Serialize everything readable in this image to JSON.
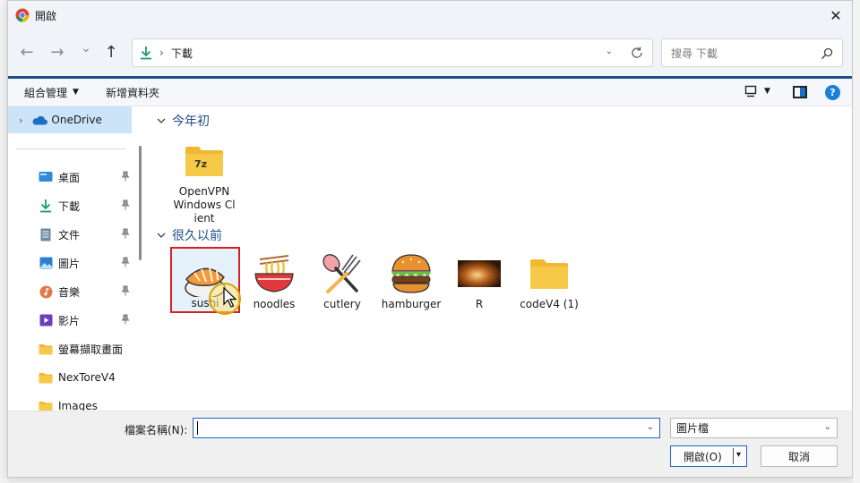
{
  "window": {
    "title": "開啟",
    "close_glyph": "✕"
  },
  "nav": {
    "back_glyph": "←",
    "forward_glyph": "→",
    "recent_glyph": "⌄",
    "up_glyph": "↑"
  },
  "address": {
    "separator": "›",
    "current": "下載",
    "dropdown_glyph": "⌄"
  },
  "search": {
    "placeholder": "搜尋 下載"
  },
  "toolbar": {
    "organize_label": "組合管理",
    "organize_caret": "▼",
    "new_folder_label": "新增資料夾",
    "view_caret": "▼",
    "help_glyph": "?"
  },
  "sidebar": {
    "onedrive": {
      "label": "OneDrive",
      "chevron": "›"
    },
    "items": [
      {
        "label": "桌面",
        "icon": "desktop-icon",
        "pinned": true
      },
      {
        "label": "下載",
        "icon": "download-icon",
        "pinned": true
      },
      {
        "label": "文件",
        "icon": "document-icon",
        "pinned": true
      },
      {
        "label": "圖片",
        "icon": "pictures-icon",
        "pinned": true
      },
      {
        "label": "音樂",
        "icon": "music-icon",
        "pinned": true
      },
      {
        "label": "影片",
        "icon": "videos-icon",
        "pinned": true
      },
      {
        "label": "螢幕擷取畫面",
        "icon": "folder-icon",
        "pinned": false
      },
      {
        "label": "NexToreV4",
        "icon": "folder-icon",
        "pinned": false
      },
      {
        "label": "Images",
        "icon": "folder-icon",
        "pinned": false
      }
    ]
  },
  "groups": [
    {
      "label": "今年初",
      "files": [
        {
          "name": "OpenVPN Windows Client",
          "icon": "zip-folder-icon"
        }
      ]
    },
    {
      "label": "很久以前",
      "files": [
        {
          "name": "sushi",
          "icon": "sushi-icon",
          "selected": true
        },
        {
          "name": "noodles",
          "icon": "noodles-icon"
        },
        {
          "name": "cutlery",
          "icon": "cutlery-icon"
        },
        {
          "name": "hamburger",
          "icon": "hamburger-icon"
        },
        {
          "name": "R",
          "icon": "image-thumbnail-icon"
        },
        {
          "name": "codeV4 (1)",
          "icon": "folder-icon"
        }
      ]
    }
  ],
  "footer": {
    "filename_label": "檔案名稱(N):",
    "filename_value": "",
    "filetype_value": "圖片檔",
    "dropdown_glyph": "⌄",
    "open_label": "開啟(O)",
    "open_caret": "▾",
    "cancel_label": "取消"
  },
  "colors": {
    "accent": "#1e4f89",
    "selection_bg": "#cce4f7",
    "selected_outline": "#d62020",
    "folder_yellow": "#f7c948"
  }
}
